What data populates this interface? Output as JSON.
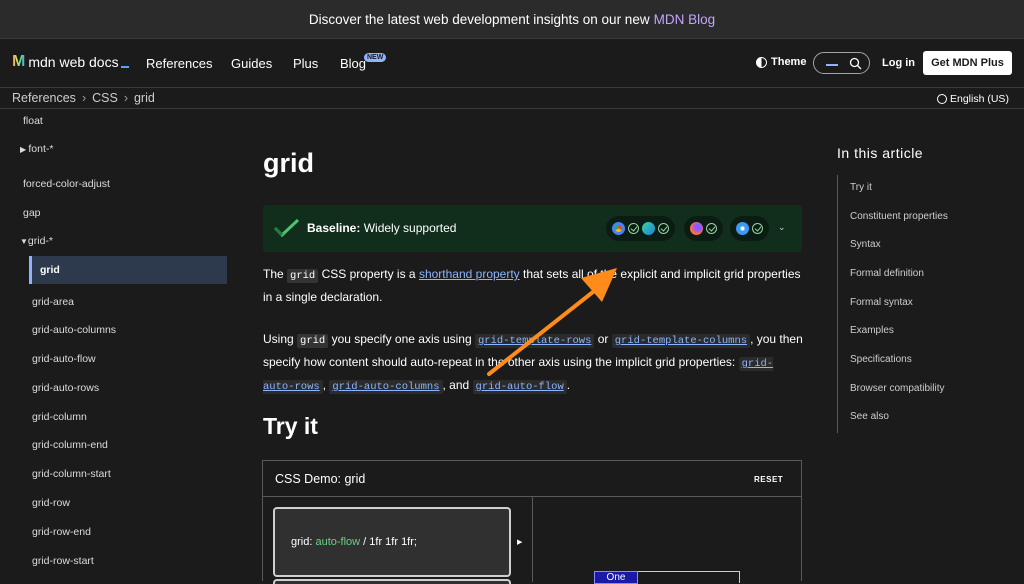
{
  "banner": {
    "text": "Discover the latest web development insights on our new",
    "link": "MDN Blog"
  },
  "header": {
    "logo": "mdn web docs",
    "nav": [
      "References",
      "Guides",
      "Plus",
      "Blog"
    ],
    "new_badge": "NEW",
    "theme": "Theme",
    "login": "Log in",
    "get_plus": "Get MDN Plus"
  },
  "breadcrumb": {
    "items": [
      "References",
      "CSS",
      "grid"
    ],
    "language": "English (US)"
  },
  "sidebar": {
    "items": [
      {
        "label": "float",
        "kind": "plain"
      },
      {
        "label": "font-*",
        "kind": "collapsed"
      },
      {
        "label": "forced-color-adjust",
        "kind": "plain"
      },
      {
        "label": "gap",
        "kind": "plain"
      },
      {
        "label": "grid-*",
        "kind": "expanded"
      },
      {
        "label": "grid",
        "kind": "active"
      },
      {
        "label": "grid-area",
        "kind": "child"
      },
      {
        "label": "grid-auto-columns",
        "kind": "child"
      },
      {
        "label": "grid-auto-flow",
        "kind": "child"
      },
      {
        "label": "grid-auto-rows",
        "kind": "child"
      },
      {
        "label": "grid-column",
        "kind": "child"
      },
      {
        "label": "grid-column-end",
        "kind": "child"
      },
      {
        "label": "grid-column-start",
        "kind": "child"
      },
      {
        "label": "grid-row",
        "kind": "child"
      },
      {
        "label": "grid-row-end",
        "kind": "child"
      },
      {
        "label": "grid-row-start",
        "kind": "child"
      }
    ]
  },
  "page": {
    "title": "grid",
    "baseline": {
      "strong": "Baseline:",
      "text": "Widely supported"
    },
    "para1": {
      "p1": "The ",
      "code": "grid",
      "p2": " CSS property is a ",
      "link": "shorthand property",
      "p3": " that sets all of the explicit and implicit grid properties in a single declaration."
    },
    "para2": {
      "p1": "Using ",
      "code": "grid",
      "p2": " you specify one axis using ",
      "l1": "grid-template-rows",
      "p3": " or ",
      "l2": "grid-template-columns",
      "p4": ", you then specify how content should auto-repeat in the other axis using the implicit grid properties: ",
      "l3": "grid-auto-rows",
      "p5": ", ",
      "l4": "grid-auto-columns",
      "p6": ", and ",
      "l5": "grid-auto-flow",
      "p7": "."
    },
    "try_it": "Try it",
    "demo": {
      "title": "CSS Demo: grid",
      "reset": "RESET",
      "code_prop": "grid: ",
      "code_kw": "auto-flow",
      "code_rest": " / 1fr 1fr 1fr;",
      "cell": "One"
    }
  },
  "toc": {
    "heading": "In this article",
    "items": [
      "Try it",
      "Constituent properties",
      "Syntax",
      "Formal definition",
      "Formal syntax",
      "Examples",
      "Specifications",
      "Browser compatibility",
      "See also"
    ]
  },
  "colors": {
    "accent": "#8cb4ff",
    "baseline_bg": "#112e1c",
    "annotation_arrow": "#ff8c1a"
  }
}
